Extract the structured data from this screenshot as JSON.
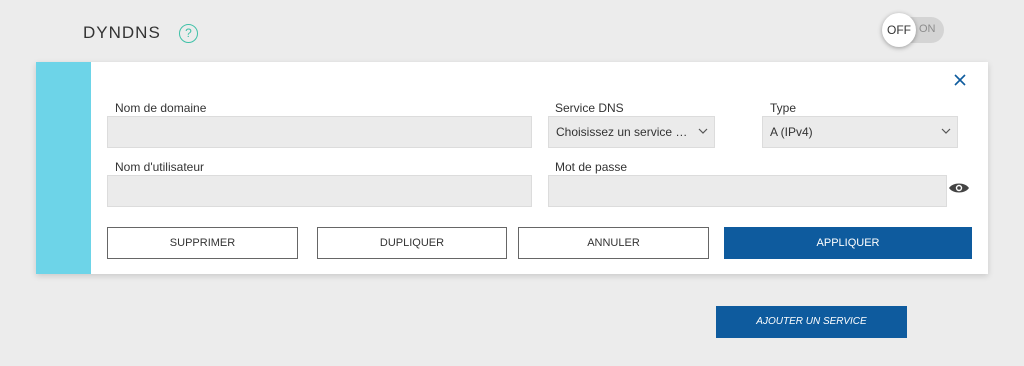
{
  "section": {
    "title": "DYNDNS",
    "help": "?"
  },
  "toggle": {
    "off_label": "OFF",
    "on_label": "ON",
    "state": "off"
  },
  "form": {
    "domain_label": "Nom de domaine",
    "domain_value": "",
    "dns_service_label": "Service DNS",
    "dns_service_value": "Choisissez un service Dy…",
    "type_label": "Type",
    "type_value": "A (IPv4)",
    "username_label": "Nom d'utilisateur",
    "username_value": "",
    "password_label": "Mot de passe",
    "password_value": ""
  },
  "buttons": {
    "delete": "SUPPRIMER",
    "duplicate": "DUPLIQUER",
    "cancel": "ANNULER",
    "apply": "APPLIQUER"
  },
  "add_service": "AJOUTER UN SERVICE",
  "colors": {
    "accent": "#6dd4e8",
    "primary": "#0e5b9e",
    "help": "#3fc1a8",
    "background": "#ececec"
  }
}
